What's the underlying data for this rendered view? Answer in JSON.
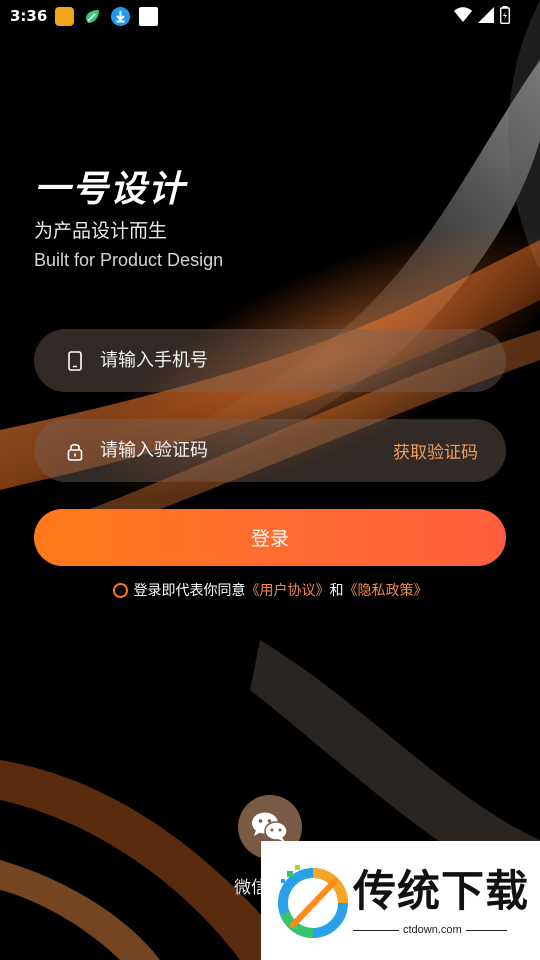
{
  "status_bar": {
    "time": "3:36",
    "icons": [
      "app-notification-icon",
      "leaf-app-icon",
      "download-icon",
      "card-app-icon"
    ],
    "right_icons": [
      "wifi-icon",
      "signal-icon",
      "battery-icon"
    ]
  },
  "brand": {
    "title": "一号设计",
    "subtitle_cn": "为产品设计而生",
    "subtitle_en": "Built for Product Design"
  },
  "form": {
    "phone_placeholder": "请输入手机号",
    "code_placeholder": "请输入验证码",
    "get_code_label": "获取验证码",
    "login_label": "登录"
  },
  "agreement": {
    "prefix": "登录即代表你同意",
    "user_agreement": "《用户协议》",
    "conjunction": "和",
    "privacy_policy": "《隐私政策》"
  },
  "wechat": {
    "label": "微信"
  },
  "watermark": {
    "name": "传统下载",
    "url": "ctdown.com"
  },
  "colors": {
    "accent": "#ff7a1a",
    "link": "#f28a4a",
    "background": "#000000"
  }
}
